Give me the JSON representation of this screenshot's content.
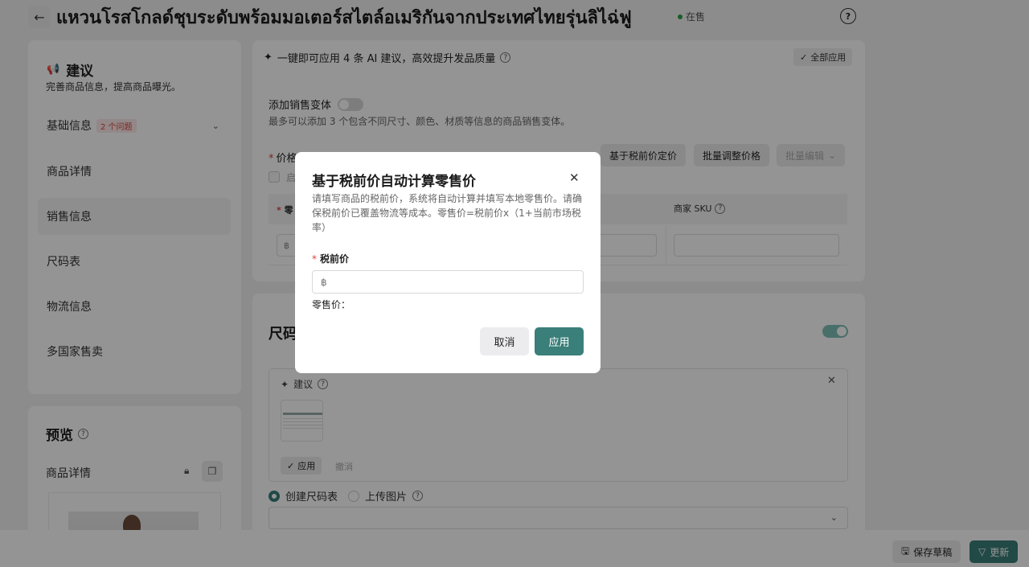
{
  "header": {
    "title": "แหวนโรสโกลด์ชุบระดับพร้อมมอเตอร์สไตล์อเมริกันจากประเทศไทยรุ่นลิไฉ่ฟู",
    "status": "在售"
  },
  "suggestions": {
    "title": "建议",
    "subtitle": "完善商品信息，提高商品曝光。",
    "nav": [
      {
        "label": "基础信息",
        "badge": "2 个问题"
      },
      {
        "label": "商品详情"
      },
      {
        "label": "销售信息"
      },
      {
        "label": "尺码表"
      },
      {
        "label": "物流信息"
      },
      {
        "label": "多国家售卖"
      }
    ]
  },
  "preview": {
    "title": "预览",
    "subtitle": "商品详情"
  },
  "main": {
    "ai_tip": "一键即可应用 4 条 AI 建议，高效提升发品质量",
    "apply_all": "全部应用",
    "variant_label": "添加销售变体",
    "variant_sub": "最多可以添加 3 个包含不同尺寸、颜色、材质等信息的商品销售变体。",
    "price_label": "价格",
    "btn_pretax": "基于税前价定价",
    "btn_batch": "批量调整价格",
    "btn_bulk": "批量编辑",
    "checkbox_label": "启",
    "col_retail": "零",
    "col_sku": "商家 SKU",
    "currency": "฿",
    "size_title": "尺码",
    "sugg_box_title": "建议",
    "apply": "应用",
    "undo": "撤消",
    "radio_create": "创建尺码表",
    "radio_upload": "上传图片"
  },
  "footer": {
    "save_draft": "保存草稿",
    "update": "更新"
  },
  "modal": {
    "title": "基于税前价自动计算零售价",
    "desc": "请填写商品的税前价，系统将自动计算并填写本地零售价。请确保税前价已覆盖物流等成本。零售价=税前价x（1+当前市场税率）",
    "field_label": "税前价",
    "input_placeholder": "฿",
    "retail_label": "零售价：",
    "cancel": "取消",
    "confirm": "应用"
  }
}
